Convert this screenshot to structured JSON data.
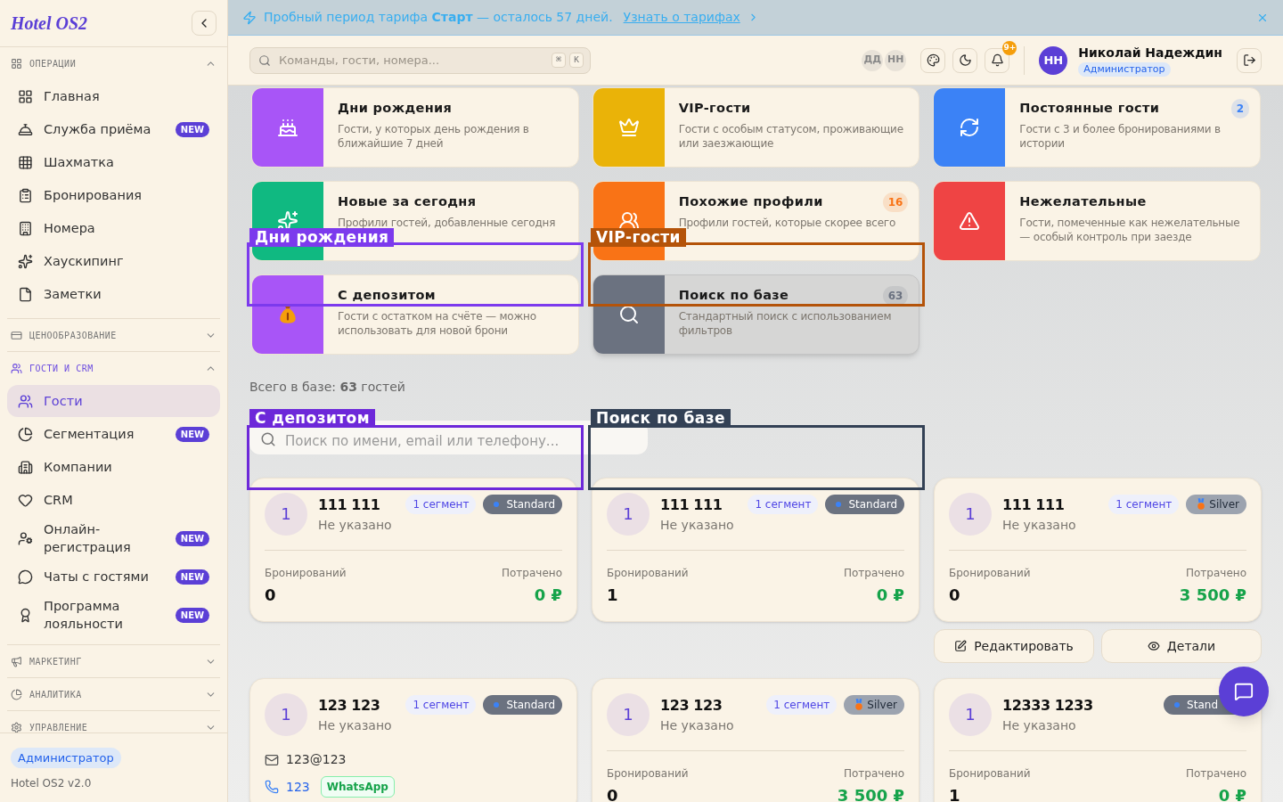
{
  "sidebar": {
    "logo": "Hotel OS2",
    "sections": [
      {
        "title": "ОПЕРАЦИИ",
        "expanded": true,
        "highlighted": false,
        "items": [
          {
            "label": "Главная",
            "selected": false
          },
          {
            "label": "Служба приёма",
            "badge": "NEW",
            "selected": false
          },
          {
            "label": "Шахматка",
            "selected": false
          },
          {
            "label": "Бронирования",
            "selected": false
          },
          {
            "label": "Номера",
            "selected": false
          },
          {
            "label": "Хаускипинг",
            "selected": false
          },
          {
            "label": "Заметки",
            "selected": false
          }
        ]
      },
      {
        "title": "ЦЕНООБРАЗОВАНИЕ",
        "expanded": false,
        "highlighted": false
      },
      {
        "title": "ГОСТИ И CRM",
        "expanded": true,
        "highlighted": true,
        "items": [
          {
            "label": "Гости",
            "selected": true
          },
          {
            "label": "Сегментация",
            "badge": "NEW",
            "selected": false
          },
          {
            "label": "Компании",
            "selected": false
          },
          {
            "label": "CRM",
            "selected": false
          },
          {
            "label": "Онлайн-регистрация",
            "badge": "NEW",
            "selected": false
          },
          {
            "label": "Чаты с гостями",
            "badge": "NEW",
            "selected": false
          },
          {
            "label": "Программа лояльности",
            "badge": "NEW",
            "selected": false
          }
        ]
      },
      {
        "title": "МАРКЕТИНГ",
        "expanded": false,
        "highlighted": false
      },
      {
        "title": "АНАЛИТИКА",
        "expanded": false,
        "highlighted": false
      },
      {
        "title": "УПРАВЛЕНИЕ",
        "expanded": false,
        "highlighted": false
      }
    ],
    "footer": {
      "role": "Администратор",
      "version": "Hotel OS2 v2.0"
    }
  },
  "banner": {
    "text": "Пробный период тарифа **Старт** — осталось 57 дней.",
    "link": "Узнать о тарифах"
  },
  "header": {
    "search": {
      "placeholder": "Команды, гости, номера..."
    },
    "shortcut": [
      "⌘",
      "K"
    ],
    "presence": [
      "ДД",
      "НН"
    ],
    "notifications": "9+",
    "user": {
      "initials": "НН",
      "name": "Николай Надеждин",
      "role": "Администратор"
    }
  },
  "categories": [
    {
      "title": "Дни рождения",
      "description": "Гости, у которых день рождения в ближайшие 7 дней",
      "color": "#a855f7",
      "selected": false
    },
    {
      "title": "VIP-гости",
      "description": "Гости с особым статусом, проживающие или заезжающие",
      "color": "#eab308",
      "selected": false
    },
    {
      "title": "Постоянные гости",
      "description": "Гости с 3 и более бронированиями в истории",
      "color": "#3b82f6",
      "count": "2",
      "selected": false
    },
    {
      "title": "Новые за сегодня",
      "description": "Профили гостей, добавленные сегодня",
      "color": "#10b981",
      "selected": false
    },
    {
      "title": "Похожие профили",
      "description": "Профили гостей, которые скорее всего",
      "color": "#f97316",
      "count": "16",
      "selected": false
    },
    {
      "title": "Нежелательные",
      "description": "Гости, помеченные как нежелательные — особый контроль при заезде",
      "color": "#ef4444",
      "selected": false
    },
    {
      "title": "С депозитом",
      "description": "Гости с остатком на счёте — можно использовать для новой брони",
      "color": "#a855f7",
      "selected": false
    },
    {
      "title": "Поиск по базе",
      "description": "Стандартный поиск с использованием фильтров",
      "color": "#6b7280",
      "count": "63",
      "selected": true
    }
  ],
  "total": "Всего в базе: **63** гостей",
  "guest_search": {
    "placeholder": "Поиск по имени, email или телефону..."
  },
  "guests": [
    {
      "avatar": "1",
      "name": "111 111",
      "subtitle": "Не указано",
      "segment": "1 сегмент",
      "tier": {
        "label": "Standard",
        "kind": "standard"
      },
      "bookings_label": "Бронирований",
      "bookings": "0",
      "spent_label": "Потрачено",
      "spent": "0 ₽"
    },
    {
      "avatar": "1",
      "name": "111 111",
      "subtitle": "Не указано",
      "segment": "1 сегмент",
      "tier": {
        "label": "Standard",
        "kind": "standard"
      },
      "bookings_label": "Бронирований",
      "bookings": "1",
      "spent_label": "Потрачено",
      "spent": "0 ₽"
    },
    {
      "avatar": "1",
      "name": "111 111",
      "subtitle": "Не указано",
      "segment": "1 сегмент",
      "tier": {
        "label": "Silver",
        "kind": "silver"
      },
      "bookings_label": "Бронирований",
      "bookings": "0",
      "spent_label": "Потрачено",
      "spent": "3 500 ₽",
      "actions": [
        "Редактировать",
        "Детали"
      ]
    },
    {
      "avatar": "1",
      "name": "123 123",
      "subtitle": "Не указано",
      "segment": "1 сегмент",
      "tier": {
        "label": "Standard",
        "kind": "standard"
      },
      "email": "123@123",
      "phone": "123",
      "messenger": "WhatsApp"
    },
    {
      "avatar": "1",
      "name": "123 123",
      "subtitle": "Не указано",
      "segment": "1 сегмент",
      "tier": {
        "label": "Silver",
        "kind": "silver"
      },
      "bookings_label": "Бронирований",
      "bookings": "0",
      "spent_label": "Потрачено",
      "spent": "3 500 ₽"
    },
    {
      "avatar": "1",
      "name": "12333 1233",
      "subtitle": "Не указано",
      "tier": {
        "label": "Stand",
        "kind": "standard"
      },
      "bookings_label": "Бронирований",
      "bookings": "1",
      "spent_label": "Потрачено",
      "spent": "0 ₽"
    }
  ],
  "overlays": [
    {
      "label": "Дни рождения",
      "color": "#7c3aed"
    },
    {
      "label": "VIP-гости",
      "color": "#b45309"
    },
    {
      "label": "С депозитом",
      "color": "#6d28d9"
    },
    {
      "label": "Поиск по базе",
      "color": "#334155"
    }
  ]
}
